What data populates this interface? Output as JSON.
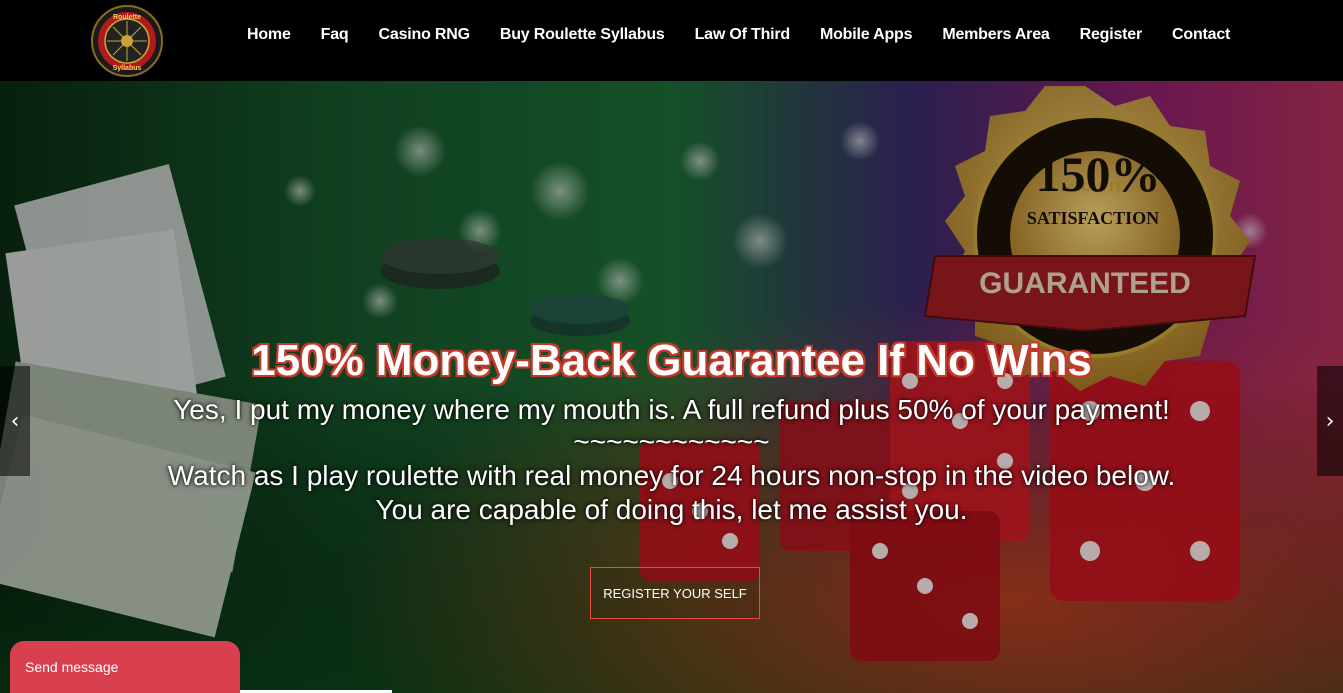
{
  "logo": {
    "text_top": "Roulette",
    "text_bottom": "Syllabus",
    "icon": "roulette-wheel-logo"
  },
  "nav": {
    "items": [
      {
        "label": "Home"
      },
      {
        "label": "Faq"
      },
      {
        "label": "Casino RNG"
      },
      {
        "label": "Buy Roulette Syllabus"
      },
      {
        "label": "Law Of Third"
      },
      {
        "label": "Mobile Apps"
      },
      {
        "label": "Members Area"
      },
      {
        "label": "Register"
      },
      {
        "label": "Contact"
      }
    ]
  },
  "hero": {
    "title": "150% Money-Back Guarantee If No Wins",
    "line1": "Yes, I put my money where my mouth is. A full refund plus 50% of your payment!",
    "line2": "~~~~~~~~~~~~",
    "line3": "Watch as I play roulette with real money for 24 hours non-stop in the video below.",
    "line4": "You are capable of doing this, let me assist you.",
    "cta_label": "REGISTER YOUR SELF",
    "badge": {
      "percent": "150%",
      "satisfaction": "SATISFACTION",
      "guaranteed": "GUARANTEED",
      "ring_text": "GUARANTEED"
    },
    "prev_arrow": "‹",
    "next_arrow": "›"
  },
  "chat": {
    "label": "Send message"
  },
  "colors": {
    "accent_red": "#d9404f",
    "cta_border": "#e74c3c",
    "nav_bg": "#000000"
  }
}
